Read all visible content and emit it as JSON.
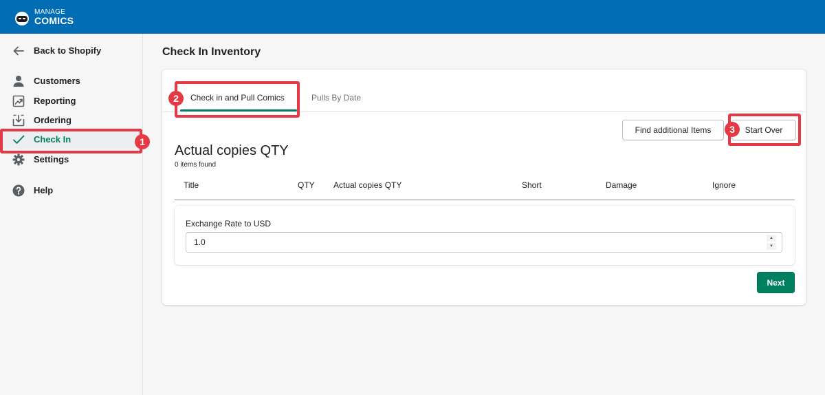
{
  "brand": {
    "line1": "MANAGE",
    "line2": "COMICS"
  },
  "sidebar": {
    "back": "Back to Shopify",
    "items": [
      {
        "label": "Customers",
        "icon": "person-icon"
      },
      {
        "label": "Reporting",
        "icon": "chart-up-icon"
      },
      {
        "label": "Ordering",
        "icon": "download-icon"
      },
      {
        "label": "Check In",
        "icon": "checkmark-icon",
        "active": true
      },
      {
        "label": "Settings",
        "icon": "gear-icon"
      },
      {
        "label": "Help",
        "icon": "question-icon"
      }
    ]
  },
  "annotations": [
    "1",
    "2",
    "3"
  ],
  "page": {
    "title": "Check In Inventory"
  },
  "tabs": [
    {
      "label": "Check in and Pull Comics",
      "active": true
    },
    {
      "label": "Pulls By Date",
      "active": false
    }
  ],
  "actions": {
    "find": "Find additional Items",
    "start_over": "Start Over",
    "next": "Next"
  },
  "section": {
    "title": "Actual copies QTY",
    "count": "0 items found"
  },
  "table": {
    "headers": [
      "Title",
      "QTY",
      "Actual copies QTY",
      "Short",
      "Damage",
      "Ignore"
    ]
  },
  "exchange": {
    "label": "Exchange Rate to USD",
    "value": "1.0"
  },
  "colors": {
    "brand": "#006cb4",
    "primary": "#008060",
    "annotation": "#e63946"
  }
}
